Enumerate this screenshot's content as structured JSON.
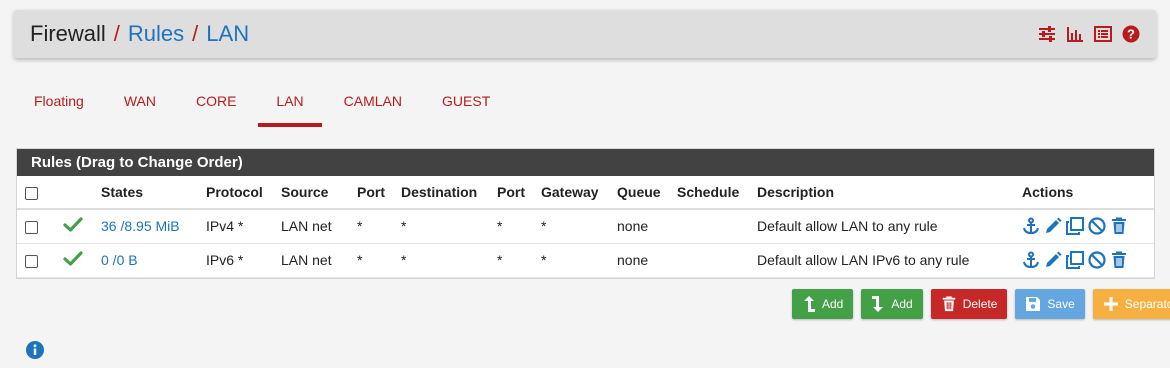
{
  "breadcrumb": {
    "root": "Firewall",
    "sep1": "/",
    "rules": "Rules",
    "sep2": "/",
    "current": "LAN"
  },
  "header_icons": [
    "sliders-icon",
    "bar-chart-icon",
    "list-icon",
    "help-icon"
  ],
  "tabs": [
    {
      "label": "Floating"
    },
    {
      "label": "WAN"
    },
    {
      "label": "CORE"
    },
    {
      "label": "LAN",
      "active": true
    },
    {
      "label": "CAMLAN"
    },
    {
      "label": "GUEST"
    }
  ],
  "panel": {
    "title": "Rules (Drag to Change Order)",
    "columns": [
      "",
      "",
      "States",
      "Protocol",
      "Source",
      "Port",
      "Destination",
      "Port",
      "Gateway",
      "Queue",
      "Schedule",
      "Description",
      "Actions"
    ],
    "rows": [
      {
        "states": "36 /8.95 MiB",
        "protocol": "IPv4 *",
        "source": "LAN net",
        "source_port": "*",
        "destination": "*",
        "dest_port": "*",
        "gateway": "*",
        "queue": "none",
        "schedule": "",
        "description": "Default allow LAN to any rule"
      },
      {
        "states": "0 /0 B",
        "protocol": "IPv6 *",
        "source": "LAN net",
        "source_port": "*",
        "destination": "*",
        "dest_port": "*",
        "gateway": "*",
        "queue": "none",
        "schedule": "",
        "description": "Default allow LAN IPv6 to any rule"
      }
    ]
  },
  "buttons": {
    "add_top": "Add",
    "add_bottom": "Add",
    "delete": "Delete",
    "save": "Save",
    "separator": "Separator"
  },
  "colors": {
    "accent_red": "#b71c1c",
    "link_blue": "#1e73be",
    "pass_green": "#43a047",
    "panel_dark": "#424242"
  }
}
